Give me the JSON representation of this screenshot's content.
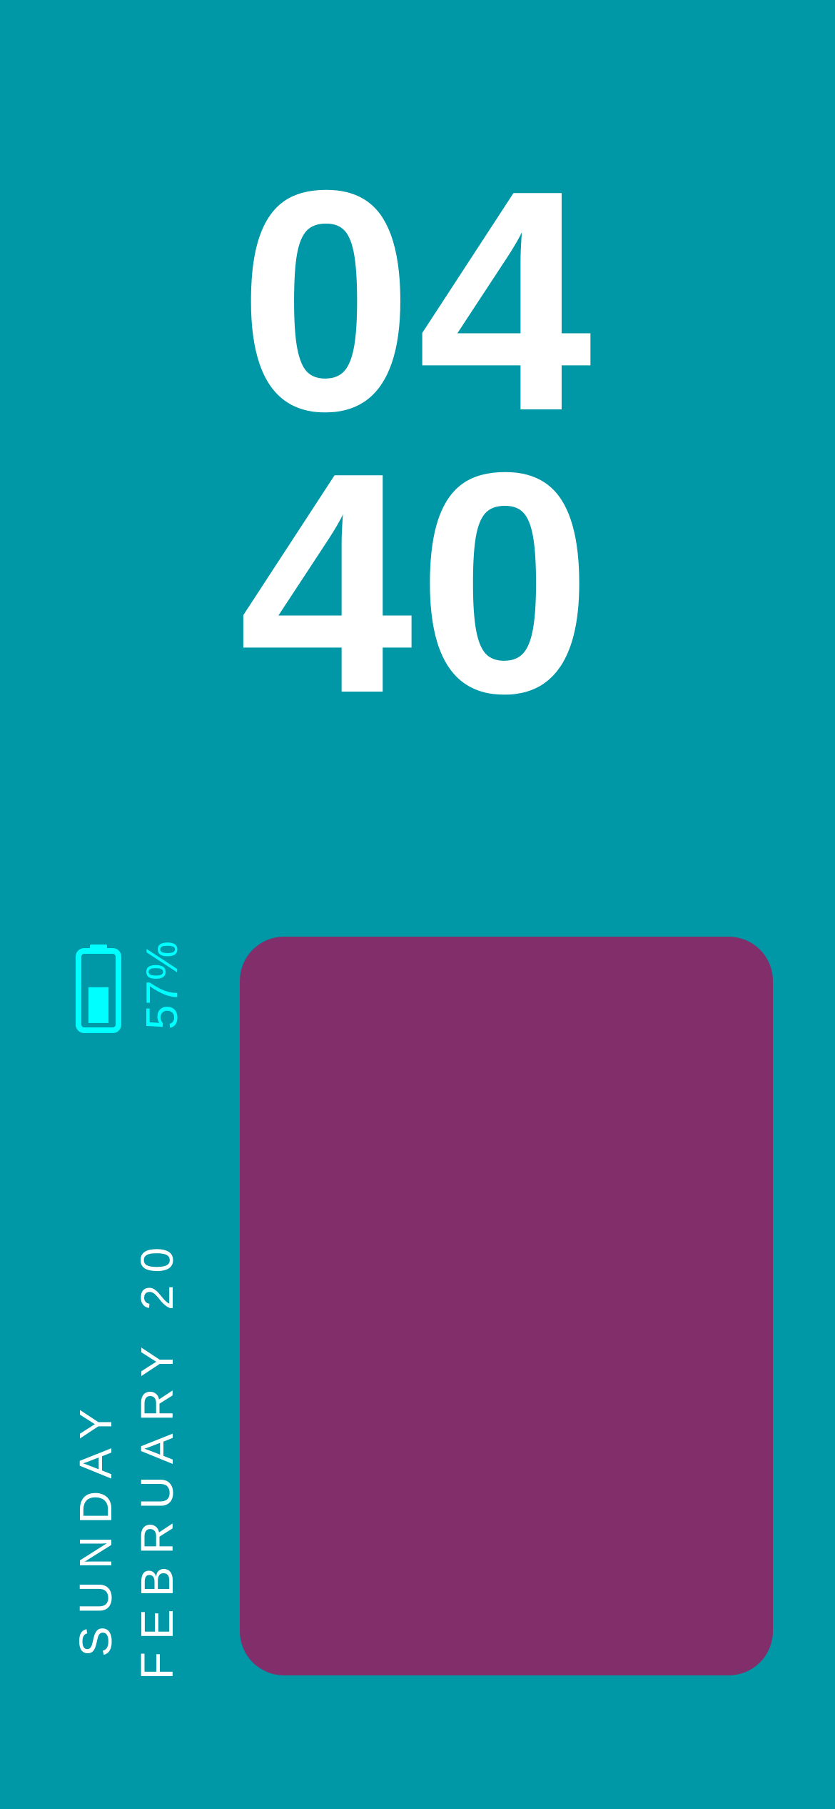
{
  "colors": {
    "background": "#0097A7",
    "clock_text": "#FFFFFF",
    "battery_accent": "#00FFFF",
    "date_text": "#FFFFFF",
    "widget_card": "#822E6A"
  },
  "clock": {
    "hours": "04",
    "minutes": "40"
  },
  "battery": {
    "icon": "battery-icon",
    "level_percent": 57,
    "label": "57%"
  },
  "date": {
    "weekday": "SUNDAY",
    "month_day": "FEBRUARY 20"
  }
}
